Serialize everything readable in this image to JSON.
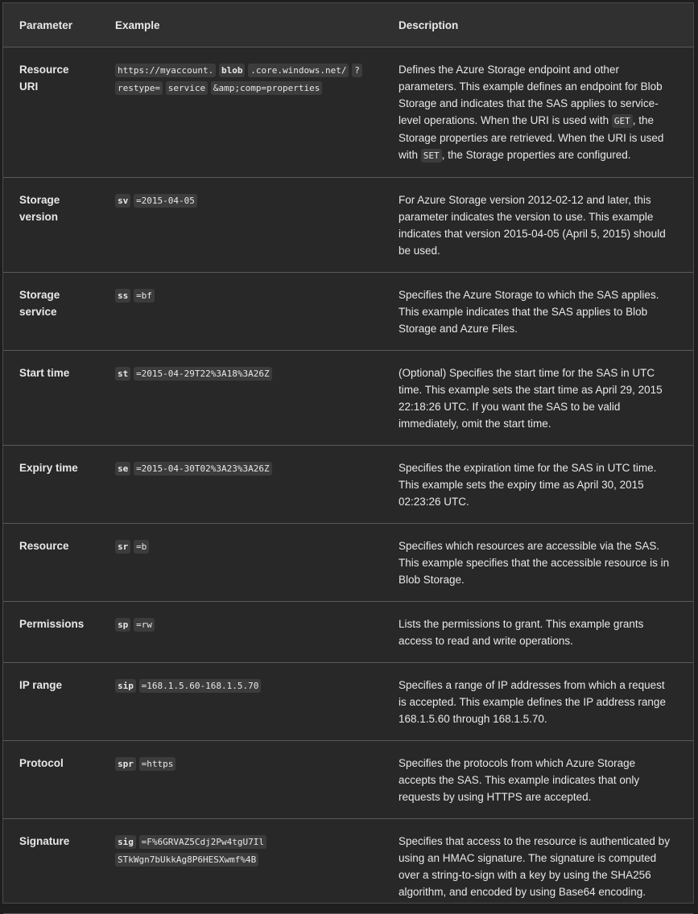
{
  "headers": {
    "parameter": "Parameter",
    "example": "Example",
    "description": "Description"
  },
  "rows": [
    {
      "param": "Resource URI",
      "example": [
        "https://myaccount.",
        "blob",
        ".core.windows.net/",
        "?",
        "restype=",
        "service",
        "&amp;comp=properties"
      ],
      "desc_parts": [
        "Defines the Azure Storage endpoint and other parameters. This example defines an endpoint for Blob Storage and indicates that the SAS applies to service-level operations. When the URI is used with ",
        "GET",
        ", the Storage properties are retrieved. When the URI is used with ",
        "SET",
        ", the Storage properties are configured."
      ]
    },
    {
      "param": "Storage version",
      "example": [
        "sv",
        "=2015-04-05"
      ],
      "desc": "For Azure Storage version 2012-02-12 and later, this parameter indicates the version to use. This example indicates that version 2015-04-05 (April 5, 2015) should be used."
    },
    {
      "param": "Storage service",
      "example": [
        "ss",
        "=bf"
      ],
      "desc": "Specifies the Azure Storage to which the SAS applies. This example indicates that the SAS applies to Blob Storage and Azure Files."
    },
    {
      "param": "Start time",
      "example": [
        "st",
        "=2015-04-29T22%3A18%3A26Z"
      ],
      "desc": "(Optional) Specifies the start time for the SAS in UTC time. This example sets the start time as April 29, 2015 22:18:26 UTC. If you want the SAS to be valid immediately, omit the start time."
    },
    {
      "param": "Expiry time",
      "example": [
        "se",
        "=2015-04-30T02%3A23%3A26Z"
      ],
      "desc": "Specifies the expiration time for the SAS in UTC time. This example sets the expiry time as April 30, 2015 02:23:26 UTC."
    },
    {
      "param": "Resource",
      "example": [
        "sr",
        "=b"
      ],
      "desc": "Specifies which resources are accessible via the SAS. This example specifies that the accessible resource is in Blob Storage."
    },
    {
      "param": "Permissions",
      "example": [
        "sp",
        "=rw"
      ],
      "desc": "Lists the permissions to grant. This example grants access to read and write operations."
    },
    {
      "param": "IP range",
      "example": [
        "sip",
        "=168.1.5.60-168.1.5.70"
      ],
      "desc": "Specifies a range of IP addresses from which a request is accepted. This example defines the IP address range 168.1.5.60 through 168.1.5.70."
    },
    {
      "param": "Protocol",
      "example": [
        "spr",
        "=https"
      ],
      "desc": "Specifies the protocols from which Azure Storage accepts the SAS. This example indicates that only requests by using HTTPS are accepted."
    },
    {
      "param": "Signature",
      "example": [
        "sig",
        "=F%6GRVAZ5Cdj2Pw4tgU7Il",
        "STkWgn7bUkkAg8P6HESXwmf%4B"
      ],
      "desc": "Specifies that access to the resource is authenticated by using an HMAC signature. The signature is computed over a string-to-sign with a key by using the SHA256 algorithm, and encoded by using Base64 encoding."
    }
  ]
}
